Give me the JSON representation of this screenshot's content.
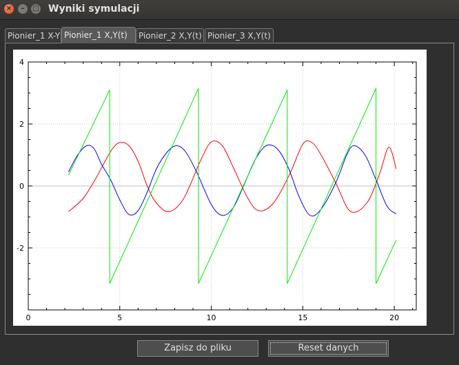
{
  "window": {
    "title": "Wyniki symulacji",
    "close_glyph": "×",
    "min_glyph": "–",
    "max_glyph": "□"
  },
  "tabs": [
    {
      "label": "Pionier_1 X-Y",
      "active": false
    },
    {
      "label": "Pionier_1 X,Y(t)",
      "active": true
    },
    {
      "label": "Pionier_2 X,Y(t)",
      "active": false
    },
    {
      "label": "Pionier_3 X,Y(t)",
      "active": false
    }
  ],
  "buttons": {
    "save": "Zapisz do pliku",
    "reset": "Reset danych"
  },
  "chart_data": {
    "type": "line",
    "title": "",
    "xlabel": "",
    "ylabel": "",
    "xlim": [
      0,
      21.2
    ],
    "ylim": [
      -4,
      4
    ],
    "xticks": [
      0,
      5,
      10,
      15,
      20
    ],
    "yticks": [
      -2,
      0,
      2,
      4
    ],
    "grid": true,
    "series": [
      {
        "color": "#ff0000",
        "x": [
          2.2,
          3.0,
          3.7,
          4.2,
          4.6,
          5.0,
          5.5,
          6.0,
          6.5,
          7.0,
          7.7,
          8.5,
          9.4,
          10.0,
          10.6,
          11.2,
          12.0,
          12.6,
          13.4,
          14.3,
          15.0,
          15.5,
          16.0,
          16.8,
          17.6,
          18.5,
          19.2,
          19.7,
          20.1
        ],
        "y": [
          -0.83,
          -0.4,
          0.25,
          0.8,
          1.2,
          1.4,
          1.3,
          0.8,
          0.0,
          -0.55,
          -0.83,
          -0.4,
          0.8,
          1.42,
          1.3,
          0.6,
          -0.4,
          -0.8,
          -0.55,
          0.4,
          1.35,
          1.4,
          1.0,
          0.1,
          -0.82,
          -0.55,
          0.4,
          1.25,
          0.55
        ]
      },
      {
        "color": "#0000ff",
        "x": [
          2.2,
          2.7,
          3.2,
          3.6,
          4.0,
          4.5,
          5.0,
          5.5,
          6.0,
          6.5,
          7.0,
          7.6,
          8.1,
          8.6,
          9.2,
          10.0,
          10.6,
          11.2,
          11.8,
          12.4,
          13.0,
          13.6,
          14.2,
          14.8,
          15.4,
          16.0,
          16.8,
          17.4,
          17.8,
          18.4,
          19.0,
          19.6,
          20.1
        ],
        "y": [
          0.45,
          1.0,
          1.3,
          1.2,
          0.7,
          0.2,
          -0.45,
          -0.92,
          -0.8,
          -0.2,
          0.55,
          1.1,
          1.3,
          1.1,
          0.45,
          -0.6,
          -0.95,
          -0.7,
          0.05,
          0.85,
          1.3,
          1.2,
          0.6,
          -0.35,
          -0.95,
          -0.75,
          0.1,
          1.0,
          1.3,
          1.0,
          0.2,
          -0.65,
          -0.9
        ]
      },
      {
        "color": "#00ee00",
        "x": [
          2.2,
          4.45,
          4.45,
          9.3,
          9.3,
          14.15,
          14.15,
          19.0,
          19.0,
          20.1
        ],
        "y": [
          0.35,
          3.1,
          -3.15,
          3.15,
          -3.15,
          3.1,
          -3.15,
          3.15,
          -3.15,
          -1.75
        ]
      }
    ]
  }
}
